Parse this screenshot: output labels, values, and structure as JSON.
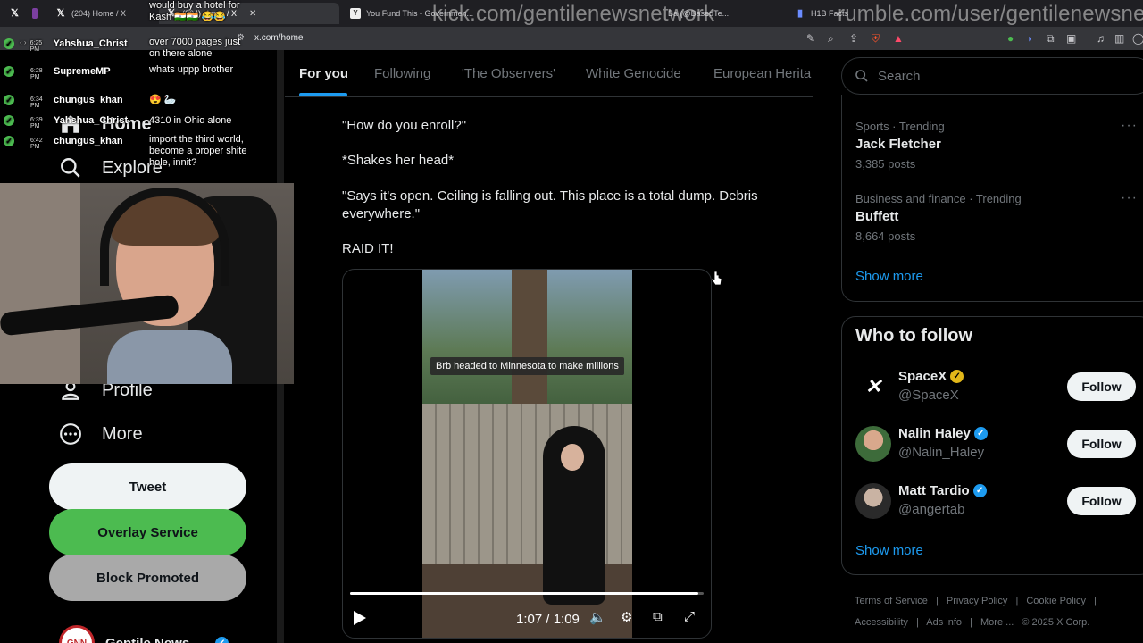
{
  "browser": {
    "tabs": [
      {
        "label": "(204) Home / X",
        "active": false
      },
      {
        "label": "(204) Home / X",
        "active": true
      },
      {
        "label": "You Fund This - Governmen...",
        "active": false
      },
      {
        "label": "Ba (@BasedTe...",
        "active": false
      },
      {
        "label": "H1B Facts",
        "active": false
      }
    ],
    "url": "x.com/home"
  },
  "stream_overlay": {
    "url_left": "kick.com/gentilenewsnetwork",
    "url_right": "rumble.com/user/gentilenewsnet",
    "chat": [
      {
        "time": "6:25 PM",
        "user": "Yahshua_Christ"
      },
      {
        "time": "6:28 PM",
        "user": "SupremeMP"
      },
      {
        "time": "6:34 PM",
        "user": "chungus_khan"
      },
      {
        "time": "6:39 PM",
        "user": "Yahshua_Christ"
      },
      {
        "time": "6:42 PM",
        "user": "chungus_khan"
      }
    ],
    "messages": [
      "would buy a hotel for Kash 🇮🇳🇮🇳 😂😂",
      "over 7000 pages just on there alone",
      "whats uppp brother",
      "😍 🦢",
      "4310 in Ohio alone",
      "import the third world, become a proper shite hole, innit?"
    ]
  },
  "left_nav": {
    "items": [
      {
        "label": "Home",
        "icon": "home-icon"
      },
      {
        "label": "Explore",
        "icon": "search-icon"
      },
      {
        "label": "Profile",
        "icon": "person-icon"
      },
      {
        "label": "More",
        "icon": "more-circle-icon"
      }
    ],
    "tweet_label": "Tweet",
    "overlay_label": "Overlay Service",
    "block_label": "Block Promoted",
    "account_name": "Gentile News ...",
    "account_logo_text": "GNN",
    "colors": {
      "overlay_green": "#4cbb50",
      "block_grey": "#a9a9a9"
    }
  },
  "feed": {
    "tabs": [
      {
        "label": "For you",
        "active": true
      },
      {
        "label": "Following",
        "active": false
      },
      {
        "label": "'The Observers'",
        "active": false
      },
      {
        "label": "White Genocide",
        "active": false
      },
      {
        "label": "European Herita",
        "active": false
      }
    ],
    "post": {
      "lines": [
        "\"How do you enroll?\"",
        "*Shakes her head*",
        "\"Says it's open. Ceiling is falling out. This place is a total dump. Debris everywhere.\"",
        "RAID IT!"
      ],
      "video": {
        "caption": "Brb headed to Minnesota to make millions",
        "time": "1:07 / 1:09",
        "progress": 0.985
      }
    }
  },
  "right": {
    "search_placeholder": "Search",
    "trends": [
      {
        "meta": "Sports · Trending",
        "name": "Jack Fletcher",
        "count": "3,385 posts"
      },
      {
        "meta": "Business and finance · Trending",
        "name": "Buffett",
        "count": "8,664 posts"
      }
    ],
    "show_more": "Show more",
    "who_to_follow": {
      "title": "Who to follow",
      "accounts": [
        {
          "name": "SpaceX",
          "handle": "@SpaceX",
          "badge": "gold"
        },
        {
          "name": "Nalin Haley",
          "handle": "@Nalin_Haley",
          "badge": "blue"
        },
        {
          "name": "Matt Tardio",
          "handle": "@angertab",
          "badge": "blue"
        }
      ],
      "follow_label": "Follow",
      "show_more": "Show more"
    },
    "footer": {
      "links": [
        "Terms of Service",
        "|",
        "Privacy Policy",
        "|",
        "Cookie Policy",
        "|"
      ],
      "links2": [
        "Accessibility",
        "|",
        "Ads info",
        "|",
        "More ...",
        "© 2025 X Corp."
      ]
    }
  },
  "colors": {
    "accent": "#1d9bf0",
    "bg": "#000000",
    "border": "#2f3336",
    "muted": "#71767b"
  }
}
